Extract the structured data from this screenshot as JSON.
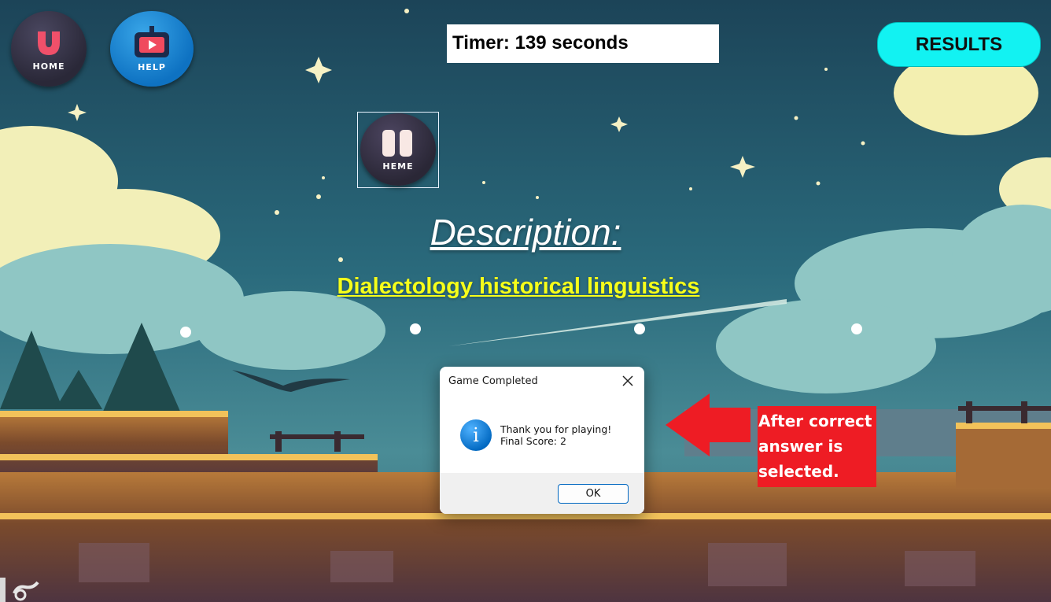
{
  "colors": {
    "sky_top": "#1d4a5e",
    "timer_bg": "#ffffff",
    "results_bg": "#12f2f2",
    "description_heading": "#ffffff",
    "description_text": "#f6ff1a",
    "callout_bg": "#ee1c24",
    "arrow": "#ee1c24"
  },
  "nav": {
    "home_label": "HOME",
    "help_label": "HELP",
    "home_icon": "magnet-u-icon",
    "help_icon": "tv-play-icon"
  },
  "theme_button": {
    "label": "HEME",
    "icon": "pause-icon"
  },
  "timer": {
    "text": "Timer: 139 seconds"
  },
  "results_button": {
    "label": "RESULTS"
  },
  "description": {
    "heading": "Description:",
    "text": "Dialectology  historical linguistics"
  },
  "options": {
    "count": 4
  },
  "dialog": {
    "title": "Game Completed",
    "message_line1": "Thank you for playing!",
    "message_line2": "Final Score: 2",
    "ok_label": "OK",
    "info_glyph": "i",
    "close_icon": "close-icon"
  },
  "annotation": {
    "line1": "After correct",
    "line2": "answer is",
    "line3": "selected."
  }
}
